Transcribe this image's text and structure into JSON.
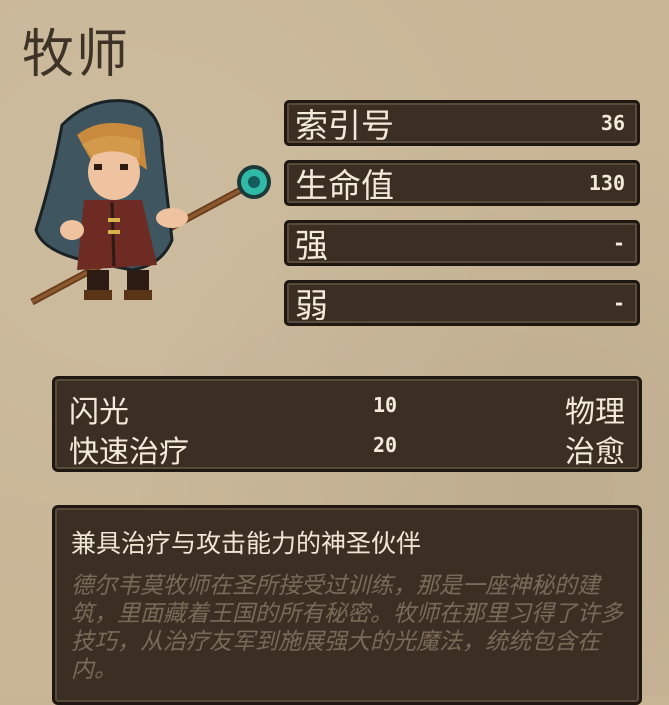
{
  "class_name": "牧师",
  "stats": [
    {
      "label": "索引号",
      "value": "36"
    },
    {
      "label": "生命值",
      "value": "130"
    },
    {
      "label": "强",
      "value": "-"
    },
    {
      "label": "弱",
      "value": "-"
    }
  ],
  "skills": [
    {
      "name": "闪光",
      "power": "10",
      "type": "物理"
    },
    {
      "name": "快速治疗",
      "power": "20",
      "type": "治愈"
    }
  ],
  "description": {
    "headline": "兼具治疗与攻击能力的神圣伙伴",
    "body": "德尔韦莫牧师在圣所接受过训练，那是一座神秘的建筑，里面藏着王国的所有秘密。牧师在那里习得了许多技巧，从治疗友军到施展强大的光魔法，统统包含在内。"
  },
  "colors": {
    "parchment": "#c9b697",
    "panel": "#3b2f24",
    "text_light": "#f3ead9"
  }
}
